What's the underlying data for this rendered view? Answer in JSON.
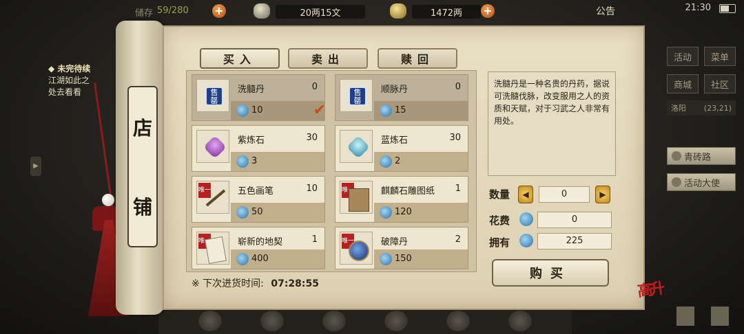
{
  "topbar": {
    "truncated_label": "储存",
    "storage": "59/280",
    "money_silver": "20两15文",
    "money_gold": "1472两",
    "notice_label": "公告",
    "clock": "21:30"
  },
  "quest": {
    "title": "◆ 未完待续",
    "line1": "江湖如此之",
    "line2": "处去看看"
  },
  "right_menu": {
    "btn1": "活动",
    "btn2": "菜单",
    "btn3": "商城",
    "btn4": "社区",
    "location_name": "洛阳",
    "location_coords": "(23,21)",
    "task1": "青砖路",
    "task2": "活动大使"
  },
  "shop": {
    "title_char1": "店",
    "title_char2": "铺",
    "tabs": [
      "买入",
      "卖出",
      "赎回"
    ],
    "active_tab": 0,
    "items": [
      {
        "name": "洗髓丹",
        "count": "0",
        "price": "10",
        "badge": "售罄",
        "selected": true
      },
      {
        "name": "顺脉丹",
        "count": "0",
        "price": "15",
        "badge": "售罄",
        "selected": false
      },
      {
        "name": "紫炼石",
        "count": "30",
        "price": "3",
        "badge": "",
        "selected": false
      },
      {
        "name": "蓝炼石",
        "count": "30",
        "price": "2",
        "badge": "",
        "selected": false
      },
      {
        "name": "五色画笔",
        "count": "10",
        "price": "50",
        "badge": "唯一",
        "selected": false
      },
      {
        "name": "麒麟石雕图纸",
        "count": "1",
        "price": "120",
        "badge": "唯一",
        "selected": false
      },
      {
        "name": "崭新的地契",
        "count": "1",
        "price": "400",
        "badge": "唯一",
        "selected": false
      },
      {
        "name": "破障丹",
        "count": "2",
        "price": "150",
        "badge": "唯一",
        "selected": false
      }
    ],
    "description": "洗髓丹是一种名贵的丹药，据说可洗髓伐脉，改变服用之人的资质和天赋，对于习武之人非常有用处。",
    "quantity_label": "数量",
    "quantity_value": "0",
    "cost_label": "花费",
    "cost_value": "0",
    "owned_label": "拥有",
    "owned_value": "225",
    "buy_button": "购买",
    "restock_label": "※ 下次进货时间:",
    "restock_time": "07:28:55",
    "seal_text": "高升"
  },
  "colors": {
    "paper": "#e9dfc4",
    "tassel": "#9b2020",
    "gem_blue": "#2e6fa6",
    "seal_red": "#c21d1d"
  }
}
